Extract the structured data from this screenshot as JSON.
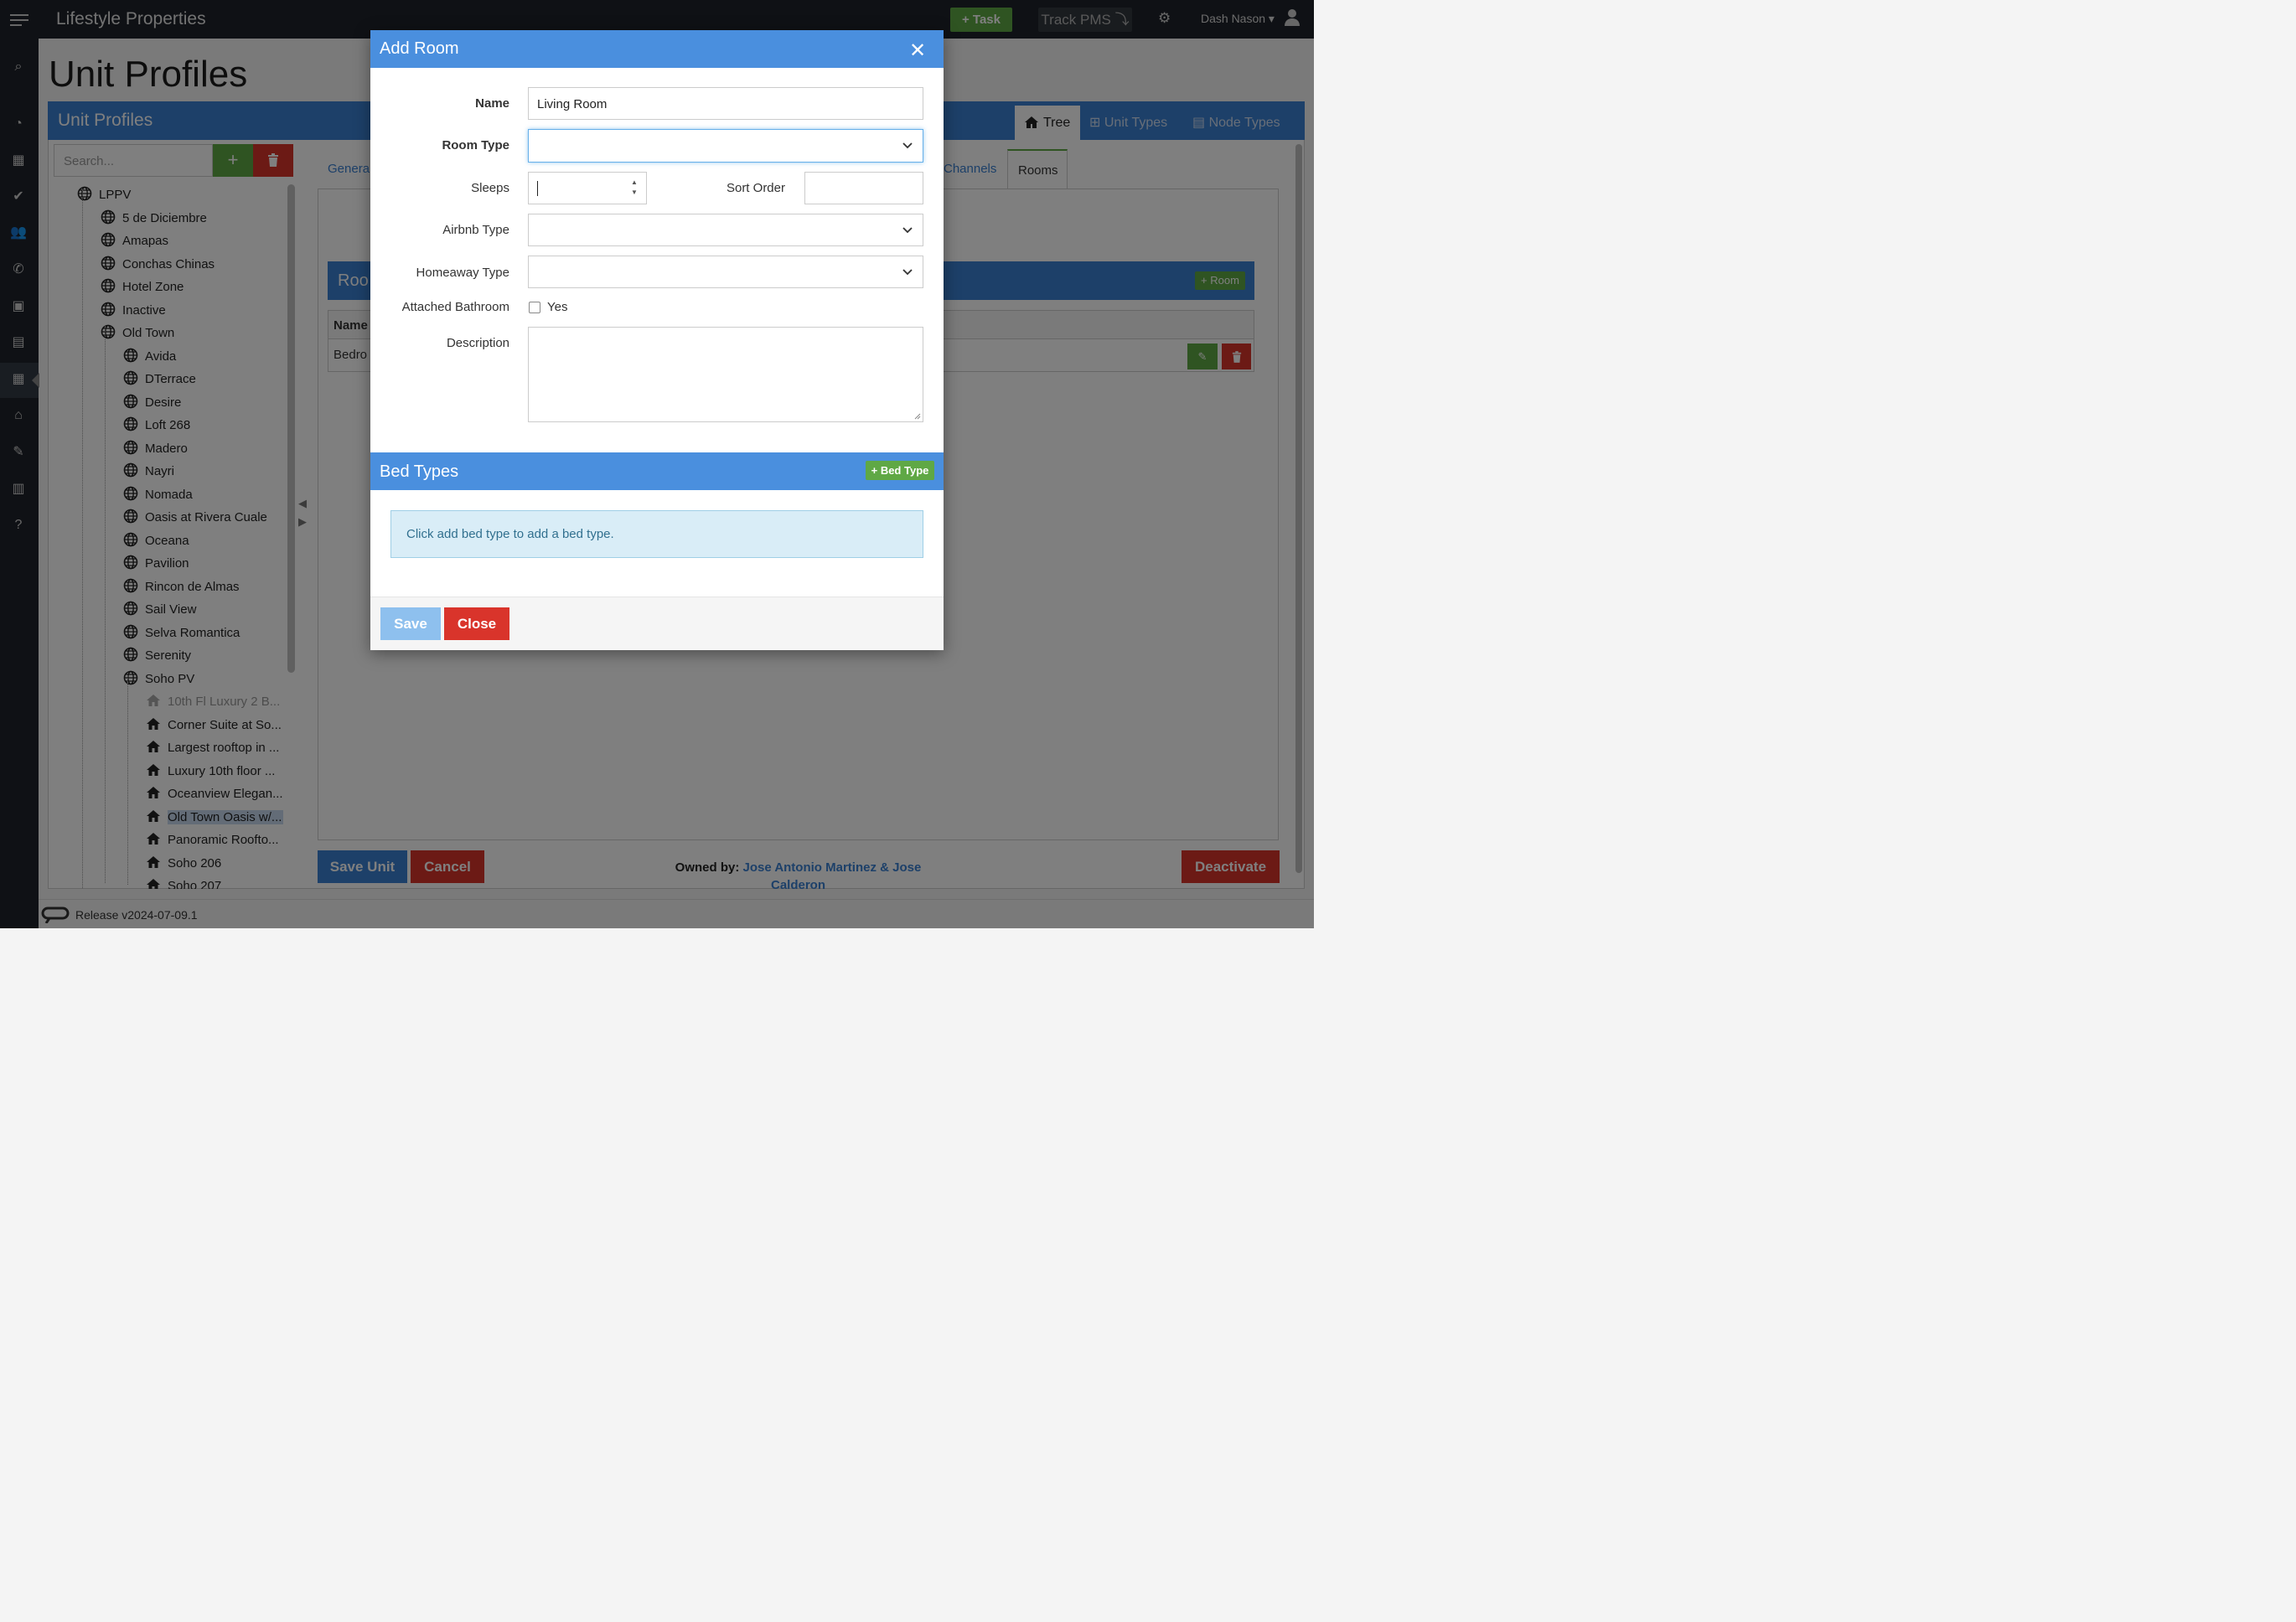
{
  "app": {
    "brand": "Lifestyle Properties",
    "task_label": "+ Task",
    "track_label": "Track PMS ⤵",
    "user_name": "Dash Nason"
  },
  "page": {
    "title": "Unit Profiles"
  },
  "panel": {
    "title": "Unit Profiles",
    "tabs": [
      "Tree",
      "Unit Types",
      "Node Types"
    ],
    "search_placeholder": "Search..."
  },
  "tree": {
    "root": "LPPV",
    "level1": [
      "5 de Diciembre",
      "Amapas",
      "Conchas Chinas",
      "Hotel Zone",
      "Inactive",
      "Old Town"
    ],
    "old_town": [
      "Avida",
      "DTerrace",
      "Desire",
      "Loft 268",
      "Madero",
      "Nayri",
      "Nomada",
      "Oasis at Rivera Cuale",
      "Oceana",
      "Pavilion",
      "Rincon de Almas",
      "Sail View",
      "Selva Romantica",
      "Serenity",
      "Soho PV"
    ],
    "soho": [
      "10th Fl Luxury 2 B...",
      "Corner Suite at So...",
      "Largest rooftop in ...",
      "Luxury 10th floor ...",
      "Oceanview Elegan...",
      "Old Town Oasis w/...",
      "Panoramic Roofto...",
      "Soho 206",
      "Soho 207"
    ]
  },
  "detail": {
    "tab_general": "Genera",
    "tab_channels": "Channels",
    "tab_rooms": "Rooms",
    "rooms_title": "Roo",
    "add_room": "+ Room",
    "col_name": "Name",
    "row_name": "Bedro",
    "save_unit": "Save Unit",
    "cancel": "Cancel",
    "owned_label": "Owned by:",
    "owner_line1": "Jose Antonio Martinez & Jose",
    "owner_line2": "Calderon",
    "deactivate": "Deactivate"
  },
  "footer": {
    "release": "Release v2024-07-09.1"
  },
  "modal": {
    "title": "Add Room",
    "name_label": "Name",
    "name_value": "Living Room",
    "room_type_label": "Room Type",
    "sleeps_label": "Sleeps",
    "sort_order_label": "Sort Order",
    "airbnb_label": "Airbnb Type",
    "homeaway_label": "Homeaway Type",
    "bathroom_label": "Attached Bathroom",
    "bathroom_yes": "Yes",
    "description_label": "Description",
    "bed_types_title": "Bed Types",
    "add_bed_type": "+ Bed Type",
    "bed_info": "Click add bed type to add a bed type.",
    "save": "Save",
    "close": "Close"
  },
  "colors": {
    "primary": "#3a80d2",
    "success": "#5fa845",
    "danger": "#d9342b",
    "topbar": "#1f232a"
  }
}
